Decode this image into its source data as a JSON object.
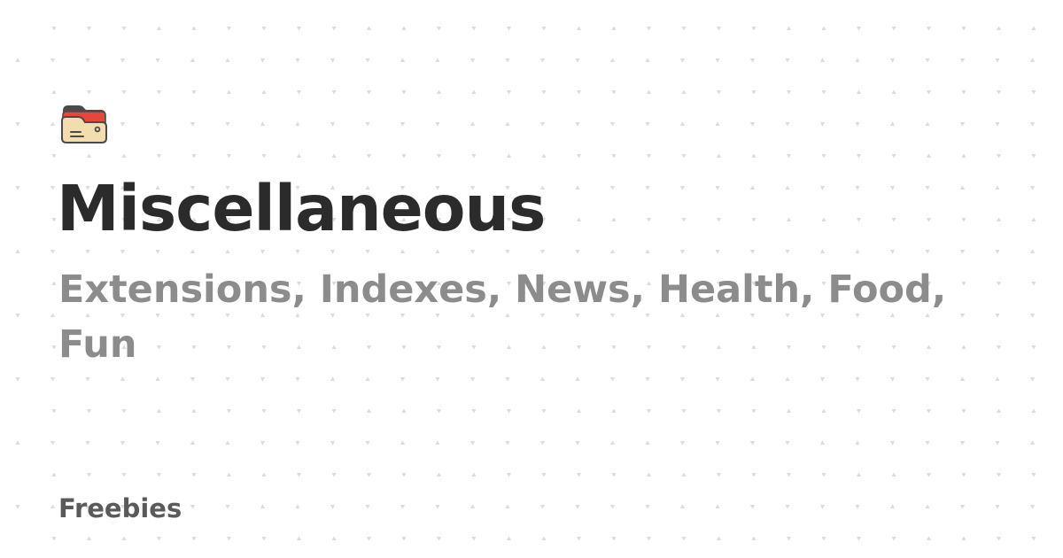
{
  "colors": {
    "background": "#ffffff",
    "title": "#2b2b2b",
    "subtitle": "#8c8c8c",
    "site_name": "#5a5a5a",
    "dot": "#dcdcdc",
    "folder_red": "#e8453c",
    "folder_dark": "#4a4a4a",
    "folder_body": "#f3dcae",
    "folder_outline": "#4a4a4a"
  },
  "icon": {
    "name": "folder-icon"
  },
  "header": {
    "title": "Miscellaneous",
    "subtitle": "Extensions, Indexes, News, Health, Food, Fun"
  },
  "footer": {
    "site_name": "Freebies"
  }
}
